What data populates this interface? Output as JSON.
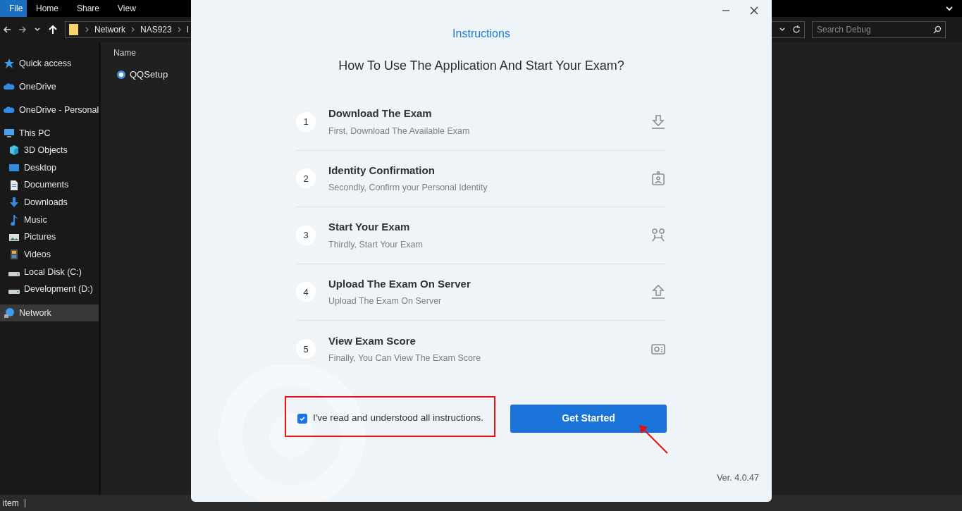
{
  "explorer": {
    "ribbon_tabs": [
      {
        "label": "File",
        "selected": true
      },
      {
        "label": "Home",
        "selected": false
      },
      {
        "label": "Share",
        "selected": false
      },
      {
        "label": "View",
        "selected": false
      }
    ],
    "breadcrumbs": [
      "Network",
      "NAS923",
      "I"
    ],
    "search": {
      "placeholder": "Search Debug"
    },
    "sidebar": [
      {
        "label": "Quick access",
        "kind": "star",
        "selected": false
      },
      {
        "label": "OneDrive",
        "kind": "cloud",
        "selected": false
      },
      {
        "label": "OneDrive - Personal",
        "kind": "cloud",
        "selected": false
      },
      {
        "label": "This PC",
        "kind": "pc",
        "selected": false,
        "children": [
          {
            "label": "3D Objects",
            "kind": "cube"
          },
          {
            "label": "Desktop",
            "kind": "desktop"
          },
          {
            "label": "Documents",
            "kind": "document"
          },
          {
            "label": "Downloads",
            "kind": "download"
          },
          {
            "label": "Music",
            "kind": "music"
          },
          {
            "label": "Pictures",
            "kind": "pictures"
          },
          {
            "label": "Videos",
            "kind": "videos"
          },
          {
            "label": "Local Disk (C:)",
            "kind": "disk"
          },
          {
            "label": "Development (D:)",
            "kind": "disk"
          }
        ]
      },
      {
        "label": "Network",
        "kind": "network",
        "selected": true
      }
    ],
    "column_header": "Name",
    "files": [
      {
        "name": "QQSetup"
      }
    ],
    "status_bar": "item"
  },
  "dialog": {
    "heading": "Instructions",
    "subtitle": "How To Use The Application And Start Your Exam?",
    "steps": [
      {
        "number": "1",
        "title": "Download The Exam",
        "description": "First, Download The Available Exam",
        "kind": "download"
      },
      {
        "number": "2",
        "title": "Identity Confirmation",
        "description": "Secondly, Confirm your Personal Identity",
        "kind": "badge"
      },
      {
        "number": "3",
        "title": "Start Your Exam",
        "description": "Thirdly, Start Your Exam",
        "kind": "people"
      },
      {
        "number": "4",
        "title": "Upload The Exam On Server",
        "description": "Upload The Exam On Server",
        "kind": "upload"
      },
      {
        "number": "5",
        "title": "View Exam Score",
        "description": "Finally, You Can View The Exam Score",
        "kind": "card"
      }
    ],
    "agreement": {
      "label": "I've read and understood all instructions.",
      "checked": true
    },
    "button": "Get Started",
    "version": "Ver. 4.0.47"
  }
}
